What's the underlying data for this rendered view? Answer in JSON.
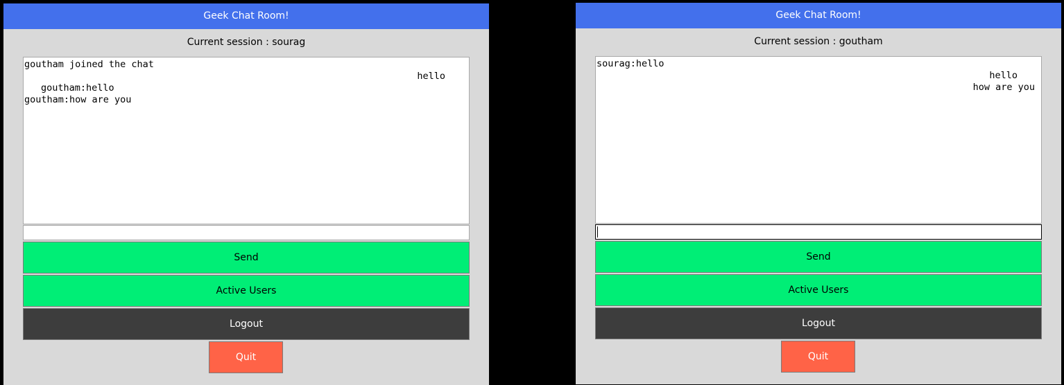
{
  "windows": [
    {
      "title": "Geek Chat Room!",
      "session_label": "Current session : sourag",
      "messages": [
        {
          "text": "goutham joined the chat",
          "align": "left"
        },
        {
          "text": "hello",
          "align": "right"
        },
        {
          "text": "goutham:hello",
          "align": "left-indent"
        },
        {
          "text": "goutham:how are you",
          "align": "left"
        }
      ],
      "input_value": "",
      "send_label": "Send",
      "active_users_label": "Active Users",
      "logout_label": "Logout",
      "quit_label": "Quit"
    },
    {
      "title": "Geek Chat Room!",
      "session_label": "Current session : goutham",
      "messages": [
        {
          "text": "sourag:hello",
          "align": "left"
        },
        {
          "text": "hello",
          "align": "right"
        },
        {
          "text": "how are you",
          "align": "right"
        }
      ],
      "input_value": "",
      "send_label": "Send",
      "active_users_label": "Active Users",
      "logout_label": "Logout",
      "quit_label": "Quit"
    }
  ],
  "colors": {
    "titlebar": "#4370ec",
    "window_bg": "#d9d9d9",
    "send_button": "#00ee76",
    "logout_button": "#3d3d3d",
    "quit_button": "#ff6347"
  }
}
